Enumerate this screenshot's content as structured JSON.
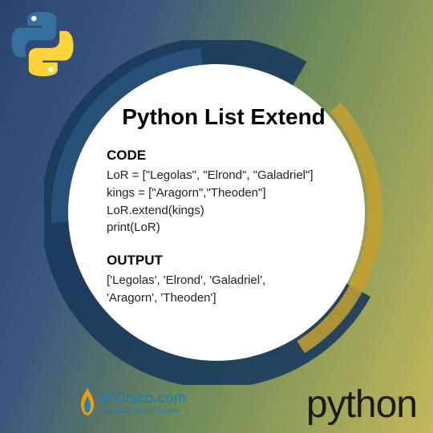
{
  "title": "Python List Extend",
  "code": {
    "label": "CODE",
    "lines": [
      "LoR = [\"Legolas\", \"Elrond\", \"Galadriel\"]",
      "kings = [\"Aragorn\",\"Theoden\"]",
      "LoR.extend(kings)",
      "print(LoR)"
    ]
  },
  "output": {
    "label": "OUTPUT",
    "lines": [
      "['Legolas', 'Elrond', 'Galadriel',",
      "'Aragorn', 'Theoden']"
    ]
  },
  "branding": {
    "site_name": "IPCisco.com",
    "tagline": "Best Route To Your Dreams"
  },
  "footer_word": "python"
}
